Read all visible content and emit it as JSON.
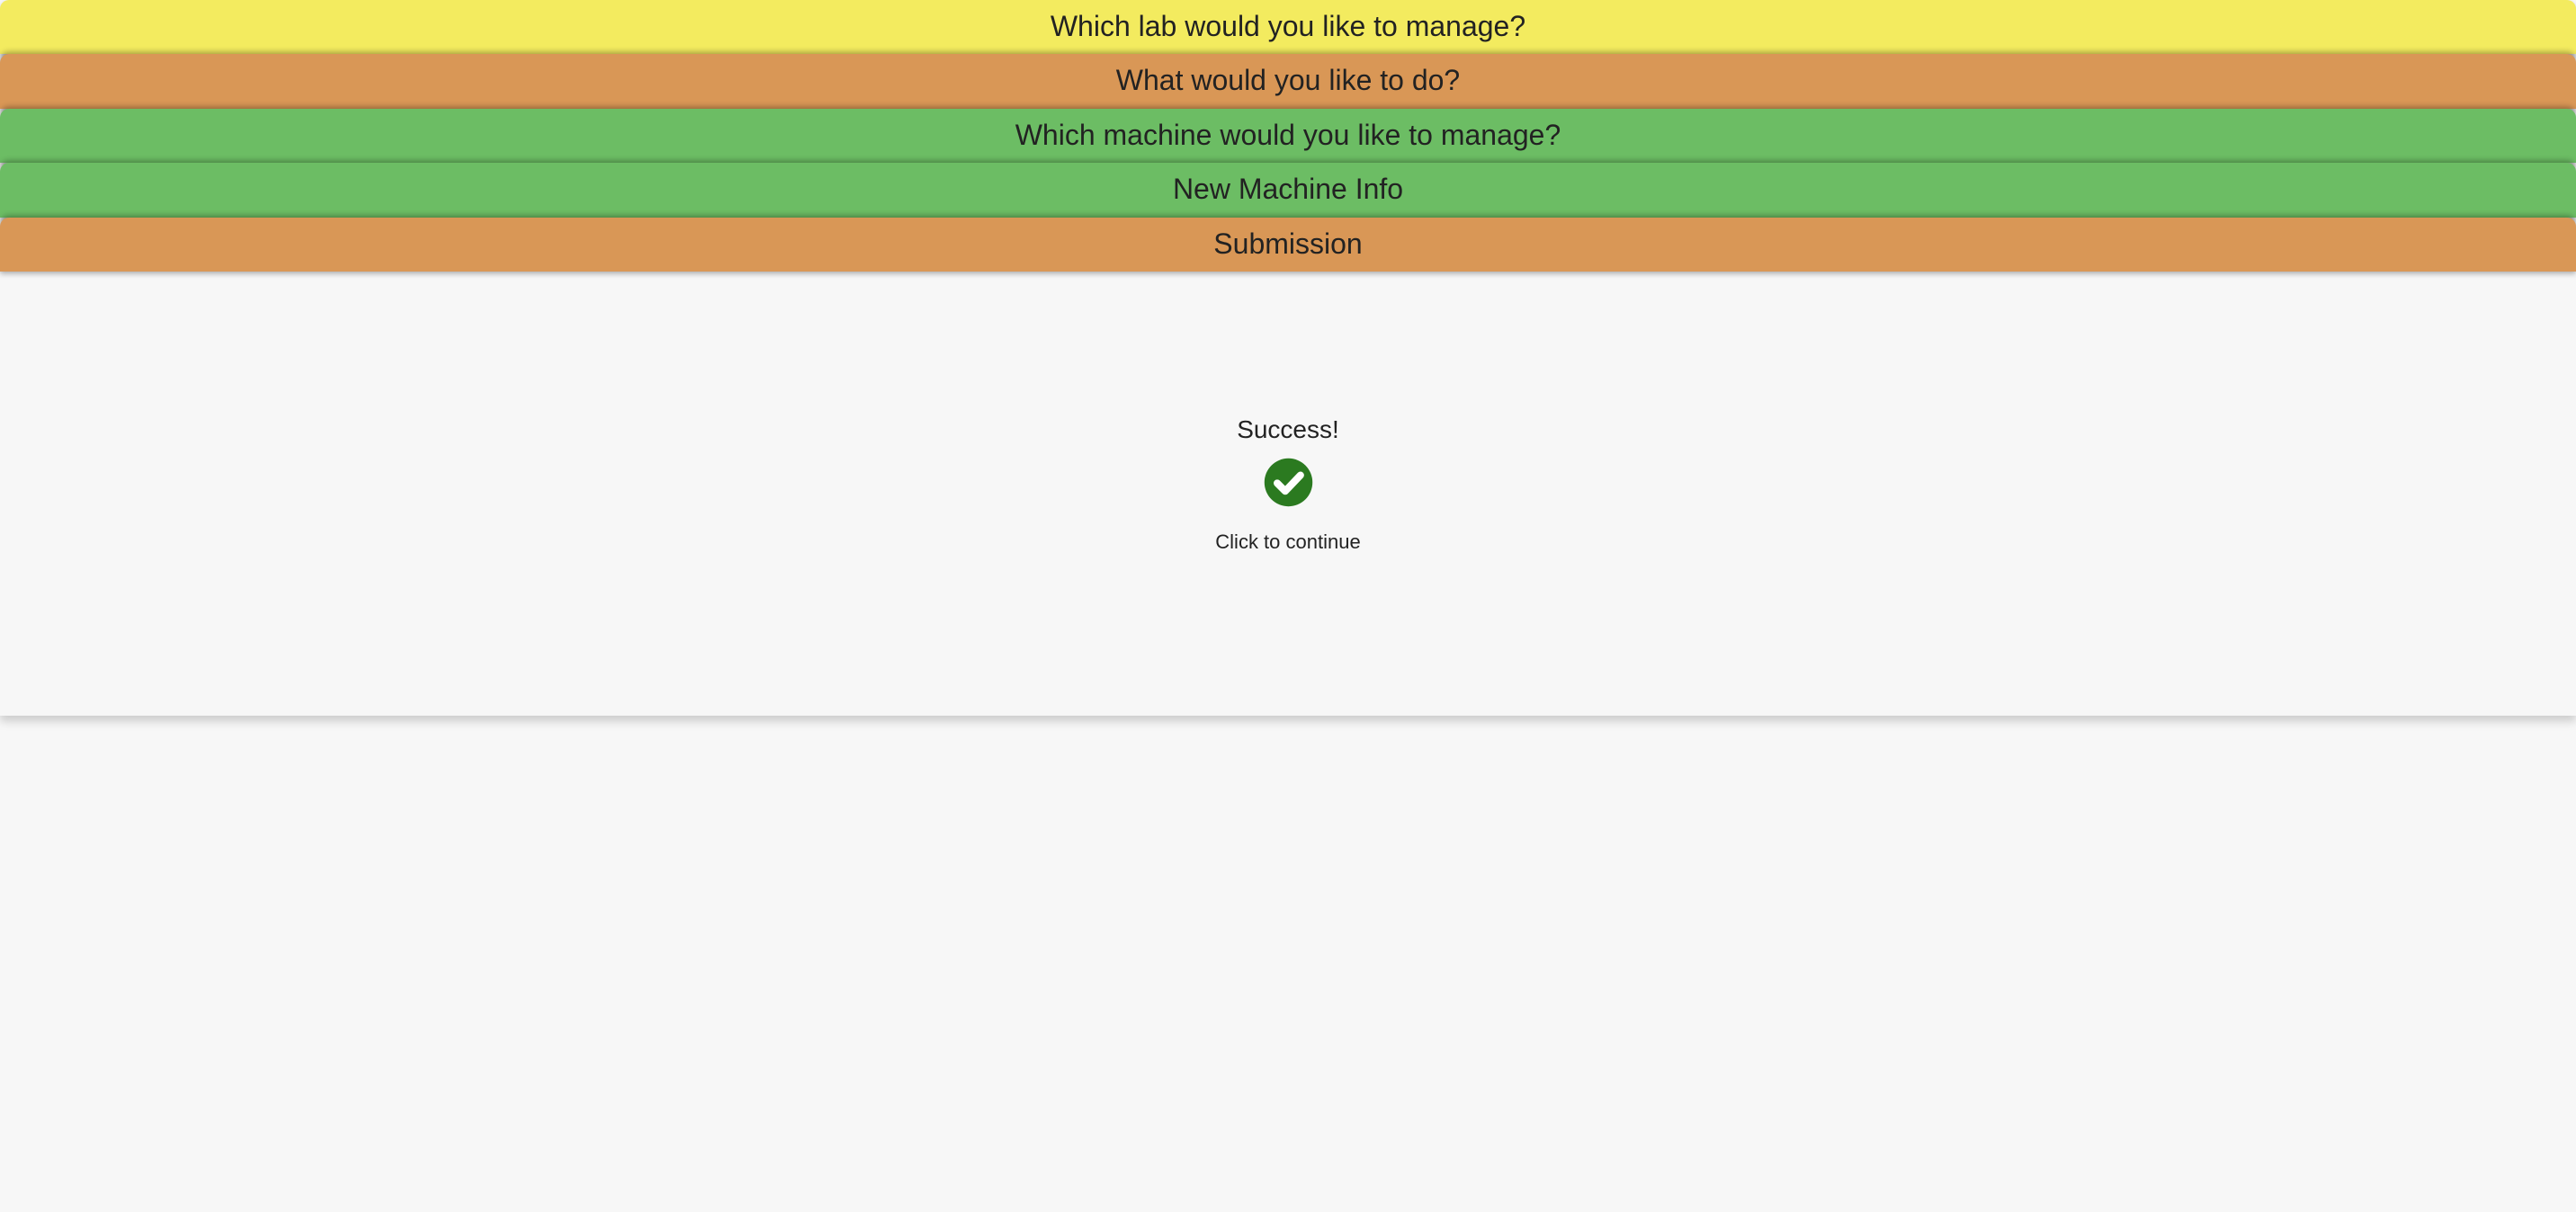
{
  "bars": {
    "lab": "Which lab would you like to manage?",
    "action": "What would you like to do?",
    "machine": "Which machine would you like to manage?",
    "new_machine": "New Machine Info",
    "submission": "Submission"
  },
  "result": {
    "title": "Success!",
    "continue": "Click to continue"
  },
  "colors": {
    "yellow": "#f3eb5f",
    "orange": "#d99756",
    "green": "#6cbd64",
    "check_bg": "#2b7a20",
    "check_fg": "#ffffff"
  }
}
